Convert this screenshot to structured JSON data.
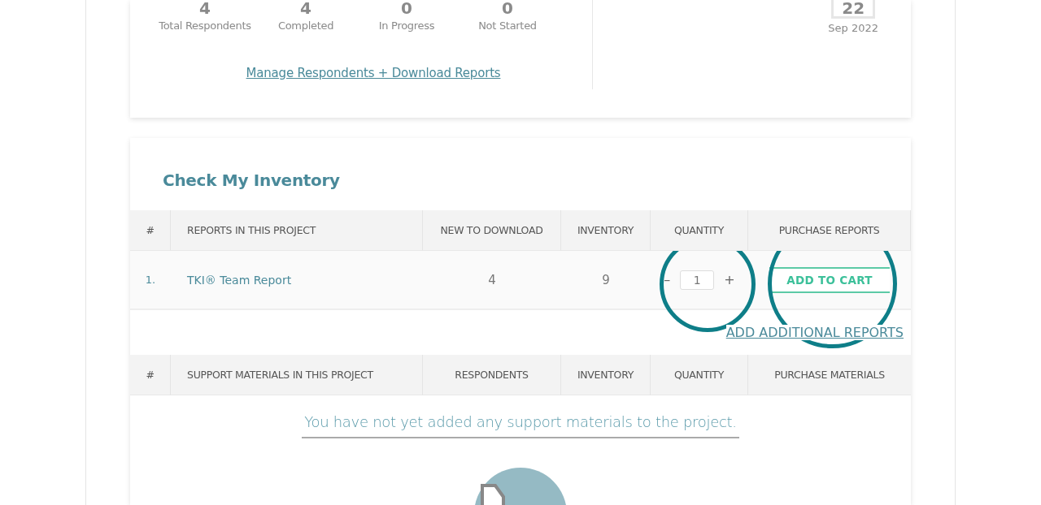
{
  "summary": {
    "stats": [
      {
        "value": "4",
        "label": "Total Respondents"
      },
      {
        "value": "4",
        "label": "Completed"
      },
      {
        "value": "0",
        "label": "In Progress"
      },
      {
        "value": "0",
        "label": "Not Started"
      }
    ],
    "link": "Manage Respondents + Download Reports",
    "date": {
      "day": "22",
      "month_year": "Sep 2022"
    }
  },
  "inventory": {
    "title": "Check My Inventory",
    "reports_table": {
      "columns": [
        "#",
        "REPORTS IN THIS PROJECT",
        "NEW TO DOWNLOAD",
        "INVENTORY",
        "QUANTITY",
        "PURCHASE REPORTS"
      ],
      "rows": [
        {
          "number": "1.",
          "report": "TKI® Team Report",
          "new_to_download": "4",
          "inventory": "9",
          "quantity": "1",
          "decrement": "–",
          "increment": "+",
          "button": "ADD TO CART"
        }
      ]
    },
    "add_link": "ADD ADDITIONAL REPORTS",
    "materials_table": {
      "columns": [
        "#",
        "SUPPORT MATERIALS IN THIS PROJECT",
        "RESPONDENTS",
        "INVENTORY",
        "QUANTITY",
        "PURCHASE MATERIALS"
      ],
      "empty_message": "You have not yet added any support materials to the project."
    }
  }
}
